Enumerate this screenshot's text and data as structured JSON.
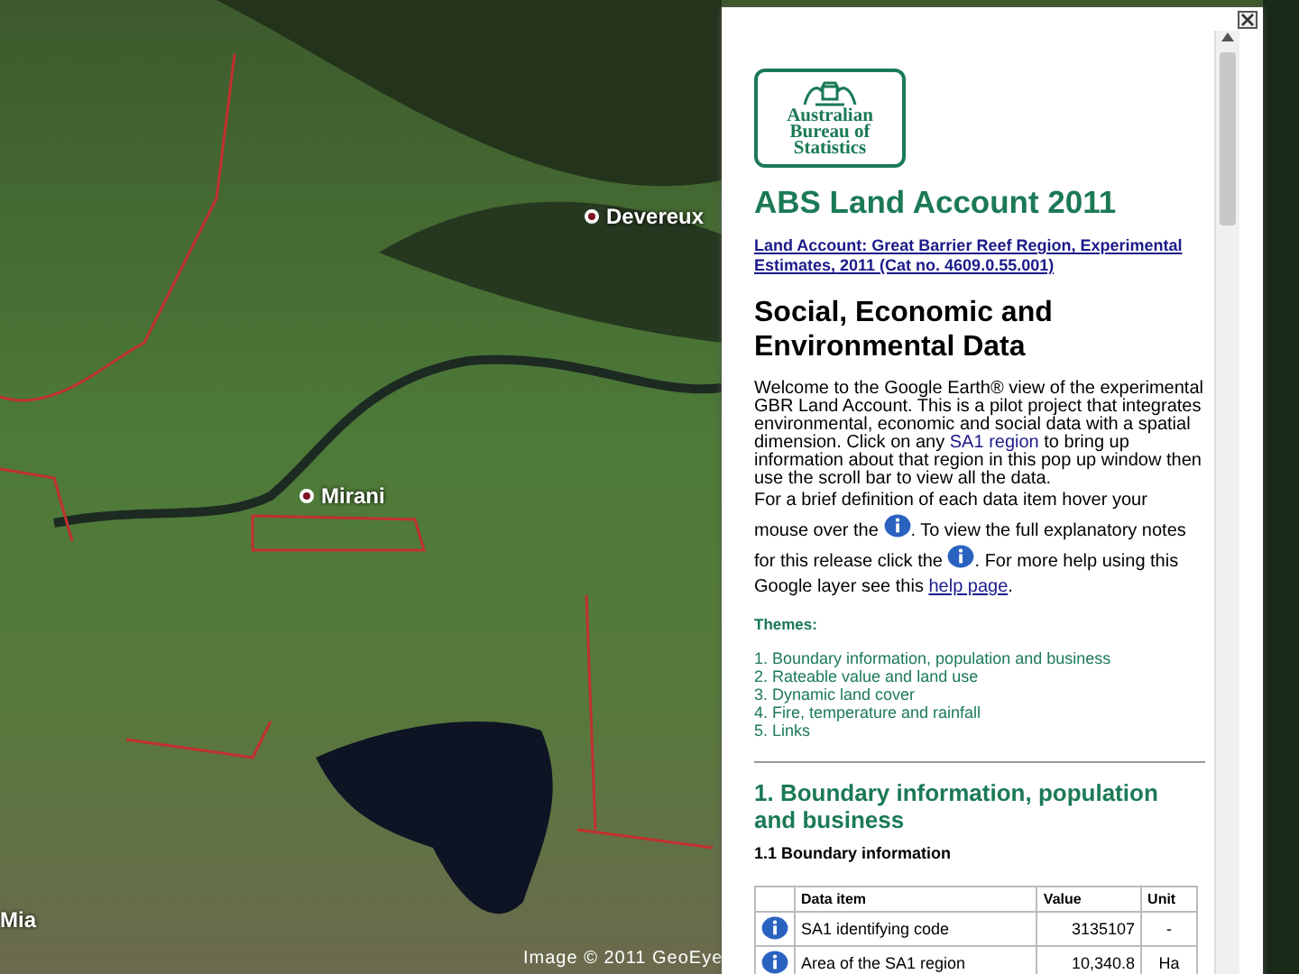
{
  "map": {
    "places": [
      {
        "name": "Devereux"
      },
      {
        "name": "Mirani"
      },
      {
        "name": "Mia"
      }
    ],
    "attribution": "Image © 2011 GeoEye"
  },
  "popup": {
    "logo_lines": [
      "Australian",
      "Bureau of",
      "Statistics"
    ],
    "title": "ABS Land Account 2011",
    "publication_link": "Land Account: Great Barrier Reef Region, Experimental Estimates, 2011 (Cat no. 4609.0.55.001)",
    "heading": "Social, Economic and Environmental Data",
    "intro": [
      {
        "kind": "text",
        "text": "Welcome to the Google Earth® view of the experimental GBR Land Account. This is a pilot project that integrates environmental, economic and social data with a spatial dimension. Click on any "
      },
      {
        "kind": "link",
        "text": "SA1 region"
      },
      {
        "kind": "text",
        "text": " to bring up information about that region in this pop up window then use the scroll bar to view all the data."
      }
    ],
    "help": [
      {
        "kind": "text",
        "text": "For a brief definition of each data item hover your mouse over the "
      },
      {
        "kind": "info"
      },
      {
        "kind": "text",
        "text": ". To view the full explanatory notes for this release click the "
      },
      {
        "kind": "info"
      },
      {
        "kind": "text",
        "text": ". For more help using this Google layer see this "
      },
      {
        "kind": "link",
        "text": "help page"
      },
      {
        "kind": "text",
        "text": "."
      }
    ],
    "themes_label": "Themes:",
    "themes": [
      "1. Boundary information, population and business",
      "2. Rateable value and land use",
      "3. Dynamic land cover",
      "4. Fire, temperature and rainfall",
      "5. Links"
    ],
    "section_heading": "1. Boundary information, population and business",
    "subsection": "1.1 Boundary information",
    "table": {
      "columns": [
        "Data item",
        "Value",
        "Unit"
      ],
      "rows": [
        {
          "item": "SA1 identifying code",
          "value": "3135107",
          "unit": "-"
        },
        {
          "item": "Area of the SA1 region",
          "value": "10,340.8",
          "unit": "Ha"
        }
      ]
    }
  }
}
